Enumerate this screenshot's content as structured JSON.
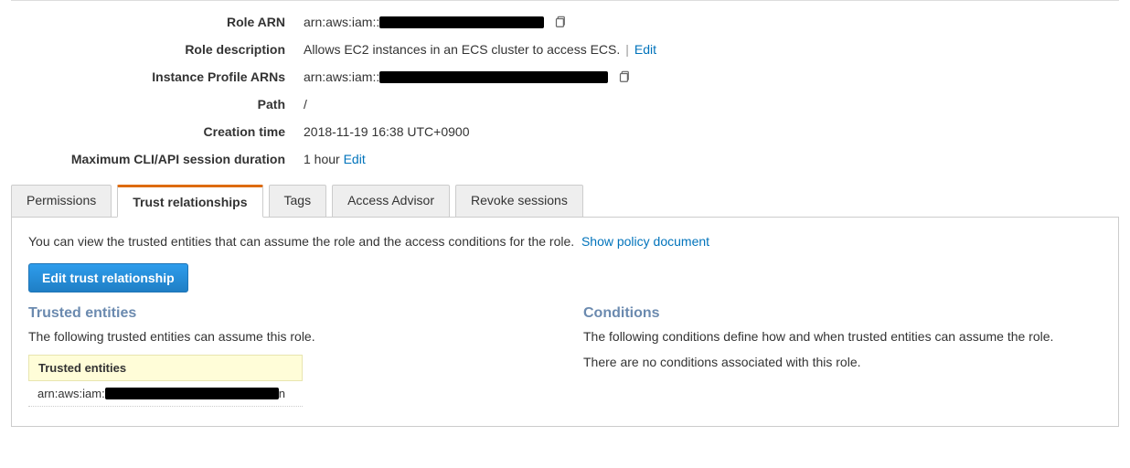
{
  "details": {
    "role_arn_label": "Role ARN",
    "role_arn_prefix": "arn:aws:iam::",
    "role_description_label": "Role description",
    "role_description_value": "Allows EC2 instances in an ECS cluster to access ECS.",
    "role_description_edit": "Edit",
    "instance_profile_label": "Instance Profile ARNs",
    "instance_profile_prefix": "arn:aws:iam::",
    "path_label": "Path",
    "path_value": "/",
    "creation_time_label": "Creation time",
    "creation_time_value": "2018-11-19 16:38 UTC+0900",
    "max_session_label": "Maximum CLI/API session duration",
    "max_session_value": "1 hour",
    "max_session_edit": "Edit"
  },
  "tabs": {
    "permissions": "Permissions",
    "trust_relationships": "Trust relationships",
    "tags": "Tags",
    "access_advisor": "Access Advisor",
    "revoke_sessions": "Revoke sessions"
  },
  "trust_panel": {
    "description": "You can view the trusted entities that can assume the role and the access conditions for the role.",
    "show_policy_link": "Show policy document",
    "edit_button": "Edit trust relationship",
    "trusted_entities_heading": "Trusted entities",
    "trusted_entities_text": "The following trusted entities can assume this role.",
    "trusted_entities_table_header": "Trusted entities",
    "trusted_entities_row_prefix": "arn:aws:iam:",
    "trusted_entities_row_suffix": "n",
    "conditions_heading": "Conditions",
    "conditions_text": "The following conditions define how and when trusted entities can assume the role.",
    "conditions_empty": "There are no conditions associated with this role."
  }
}
